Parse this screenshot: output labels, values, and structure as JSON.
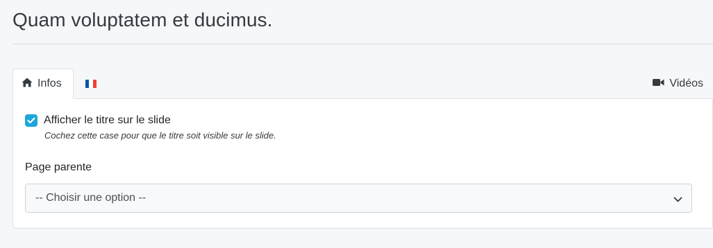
{
  "page": {
    "title": "Quam voluptatem et ducimus."
  },
  "tabs": {
    "infos": {
      "label": "Infos",
      "icon": "home-icon"
    },
    "french": {
      "icon": "france-flag-icon",
      "flag_colors": [
        "#0055a4",
        "#ffffff",
        "#ef4135"
      ]
    },
    "videos": {
      "label": "Vidéos",
      "icon": "video-camera-icon"
    }
  },
  "form": {
    "show_title": {
      "label": "Afficher le titre sur le slide",
      "help": "Cochez cette case pour que le titre soit visible sur le slide.",
      "checked": true
    },
    "parent_page": {
      "label": "Page parente",
      "selected": "-- Choisir une option --"
    }
  },
  "colors": {
    "accent": "#1aa6db",
    "text": "#212529"
  }
}
